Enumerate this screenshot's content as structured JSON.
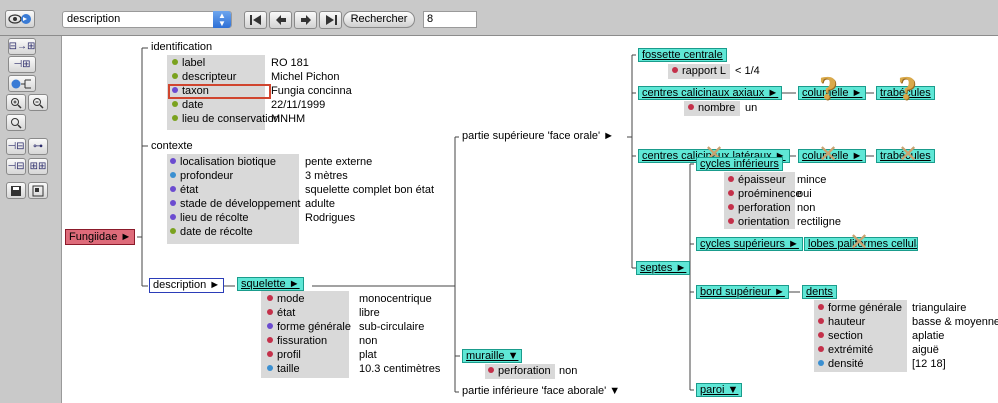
{
  "toolbar": {
    "select_value": "description",
    "search_label": "Rechercher",
    "count": "8",
    "icons": [
      "view-toggle-icon",
      "first-icon",
      "previous-icon",
      "next-icon",
      "last-icon"
    ]
  },
  "sidebar": {
    "icons": [
      "expand-horizontal-icon",
      "tree-add-icon",
      "tree-move-icon",
      "tree-split-icon",
      "color-tree-icon",
      "tree-link-icon",
      "zoom-in-icon",
      "zoom-out-icon",
      "zoom-reset-icon",
      "collapse-icon",
      "expand-icon",
      "collapse-all-icon",
      "expand-all-icon",
      "save-icon",
      "print-icon"
    ]
  },
  "tree": {
    "root": "Fungiidae ►",
    "identification": {
      "title": "identification",
      "rows": [
        {
          "attr": "label",
          "value": "RO 181",
          "dot": "g"
        },
        {
          "attr": "descripteur",
          "value": "Michel Pichon",
          "dot": "g"
        },
        {
          "attr": "taxon",
          "value": "Fungia concinna",
          "dot": "p"
        },
        {
          "attr": "date",
          "value": "22/11/1999",
          "dot": "g"
        },
        {
          "attr": "lieu de conservation",
          "value": "MNHM",
          "dot": "g"
        }
      ]
    },
    "contexte": {
      "title": "contexte",
      "rows": [
        {
          "attr": "localisation biotique",
          "value": "pente externe",
          "dot": "p"
        },
        {
          "attr": "profondeur",
          "value": "3 mètres",
          "dot": "b"
        },
        {
          "attr": "état",
          "value": "squelette complet bon état",
          "dot": "p"
        },
        {
          "attr": "stade de développement",
          "value": "adulte",
          "dot": "p"
        },
        {
          "attr": "lieu de récolte",
          "value": "Rodrigues",
          "dot": "p"
        },
        {
          "attr": "date de récolte",
          "value": "",
          "dot": "g"
        }
      ]
    },
    "description": "description ►",
    "squelette": {
      "title": "squelette ►",
      "rows": [
        {
          "attr": "mode",
          "value": "monocentrique",
          "dot": "r"
        },
        {
          "attr": "état",
          "value": "libre",
          "dot": "r"
        },
        {
          "attr": "forme générale",
          "value": "sub-circulaire",
          "dot": "p"
        },
        {
          "attr": "fissuration",
          "value": "non",
          "dot": "r"
        },
        {
          "attr": "profil",
          "value": "plat",
          "dot": "r"
        },
        {
          "attr": "taille",
          "value": "10.3 centimètres",
          "dot": "b"
        }
      ]
    },
    "partie_sup": "partie supérieure 'face orale' ►",
    "partie_inf": "partie inférieure 'face aborale' ▼",
    "muraille": {
      "title": "muraille ▼",
      "attr": "perforation",
      "value": "non"
    },
    "fossette": {
      "title": "fossette centrale",
      "attr": "rapport L",
      "value": "< 1/4"
    },
    "centres_axiaux": {
      "title": "centres calicinaux axiaux ►",
      "attr": "nombre",
      "value": "un"
    },
    "columelle_1": "columelle ►",
    "trabecules_1": "trabécules",
    "centres_lateraux": "centres calicinaux latéraux ►",
    "columelle_2": "columelle ►",
    "trabecules_2": "trabécules",
    "septes": "septes ►",
    "cycles_inf": {
      "title": "cycles inférieurs",
      "rows": [
        {
          "attr": "épaisseur",
          "value": "mince",
          "dot": "r"
        },
        {
          "attr": "proéminence",
          "value": "oui",
          "dot": "r"
        },
        {
          "attr": "perforation",
          "value": "non",
          "dot": "r"
        },
        {
          "attr": "orientation",
          "value": "rectiligne",
          "dot": "r"
        }
      ]
    },
    "cycles_sup": "cycles supérieurs ►",
    "lobes": "lobes paliformes cellulaires",
    "bord_sup": "bord supérieur ►",
    "dents": {
      "title": "dents",
      "rows": [
        {
          "attr": "forme générale",
          "value": "triangulaire",
          "dot": "r"
        },
        {
          "attr": "hauteur",
          "value": "basse & moyenne",
          "dot": "r"
        },
        {
          "attr": "section",
          "value": "aplatie",
          "dot": "r"
        },
        {
          "attr": "extrémité",
          "value": "aiguë",
          "dot": "r"
        },
        {
          "attr": "densité",
          "value": "[12 18]",
          "dot": "b"
        }
      ]
    },
    "paroi": "paroi ▼"
  }
}
